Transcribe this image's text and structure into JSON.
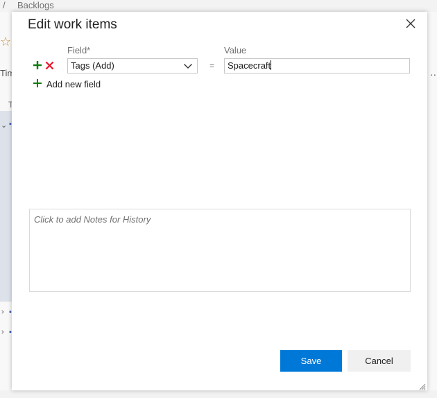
{
  "background": {
    "breadcrumb_separator": "/",
    "breadcrumb_label": "Backlogs",
    "tab_fragment": "Tim",
    "column_fragment": "T",
    "more_dots": "..."
  },
  "dialog": {
    "title": "Edit work items",
    "field_column_label": "Field*",
    "value_column_label": "Value",
    "rows": [
      {
        "field": "Tags (Add)",
        "operator": "=",
        "value": "Spacecraft"
      }
    ],
    "add_new_field_label": "Add new field",
    "notes_placeholder": "Click to add Notes for History",
    "save_label": "Save",
    "cancel_label": "Cancel"
  },
  "colors": {
    "primary": "#0078d7",
    "add_icon": "#107c10",
    "remove_icon": "#e81123"
  },
  "icons": {
    "close": "close-icon",
    "add_row": "plus-icon",
    "remove_row": "x-icon",
    "dropdown": "chevron-down-icon",
    "resize": "resize-grip-icon"
  }
}
